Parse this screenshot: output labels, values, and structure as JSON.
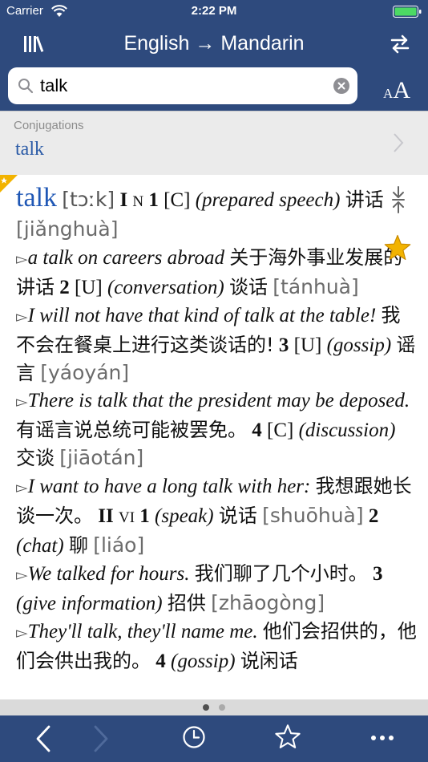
{
  "status": {
    "carrier": "Carrier",
    "time": "2:22 PM"
  },
  "nav": {
    "title": "English → Mandarin"
  },
  "search": {
    "value": "talk",
    "font_button_small": "A",
    "font_button_big": "A"
  },
  "conjugations": {
    "title": "Conjugations",
    "word": "talk"
  },
  "entry": {
    "headword": "talk",
    "phonetic": "[tɔːk]",
    "roman1": "I",
    "pos_n": "N",
    "s1_num": "1",
    "s1_gram": "[C]",
    "s1_gloss": "(prepared speech)",
    "s1_zh": "讲话",
    "s1_py": "[jiǎnghuà]",
    "ex1_en": "a talk on careers abroad",
    "ex1_zh": "关于海外事业发展的讲话",
    "s2_num": "2",
    "s2_gram": "[U]",
    "s2_gloss": "(conversation)",
    "s2_zh": "谈话",
    "s2_py": "[tánhuà]",
    "ex2_en": "I will not have that kind of talk at the table!",
    "ex2_zh": "我不会在餐桌上进行这类谈话的!",
    "s3_num": "3",
    "s3_gram": "[U]",
    "s3_gloss": "(gossip)",
    "s3_zh": "谣言",
    "s3_py": "[yáoyán]",
    "ex3_en": "There is talk that the president may be deposed.",
    "ex3_zh": "有谣言说总统可能被罢免。",
    "s4_num": "4",
    "s4_gram": "[C]",
    "s4_gloss": "(discussion)",
    "s4_zh": "交谈",
    "s4_py": "[jiāotán]",
    "ex4_en": "I want to have a long talk with her:",
    "ex4_zh": "我想跟她长谈一次。",
    "roman2": "II",
    "pos_vi": "VI",
    "v1_num": "1",
    "v1_gloss": "(speak)",
    "v1_zh": "说话",
    "v1_py": "[shuōhuà]",
    "v2_num": "2",
    "v2_gloss": "(chat)",
    "v2_zh": "聊",
    "v2_py": "[liáo]",
    "ex5_en": "We talked for hours.",
    "ex5_zh": "我们聊了几个小时。",
    "v3_num": "3",
    "v3_gloss": "(give information)",
    "v3_zh": "招供",
    "v3_py": "[zhāogòng]",
    "ex6_en": "They'll talk, they'll name me.",
    "ex6_zh": "他们会招供的，他们会供出我的。",
    "v4_num": "4",
    "v4_gloss": "(gossip)",
    "v4_zh": "说闲话"
  },
  "colors": {
    "bar": "#2e4a7d",
    "headword": "#1f57b5",
    "star": "#f2b300"
  },
  "icons": [
    "library-icon",
    "swap-icon",
    "search-icon",
    "clear-icon",
    "chevron-right-icon",
    "collapse-icon",
    "star-icon",
    "back-icon",
    "forward-icon",
    "history-icon",
    "favorites-icon",
    "more-icon"
  ]
}
